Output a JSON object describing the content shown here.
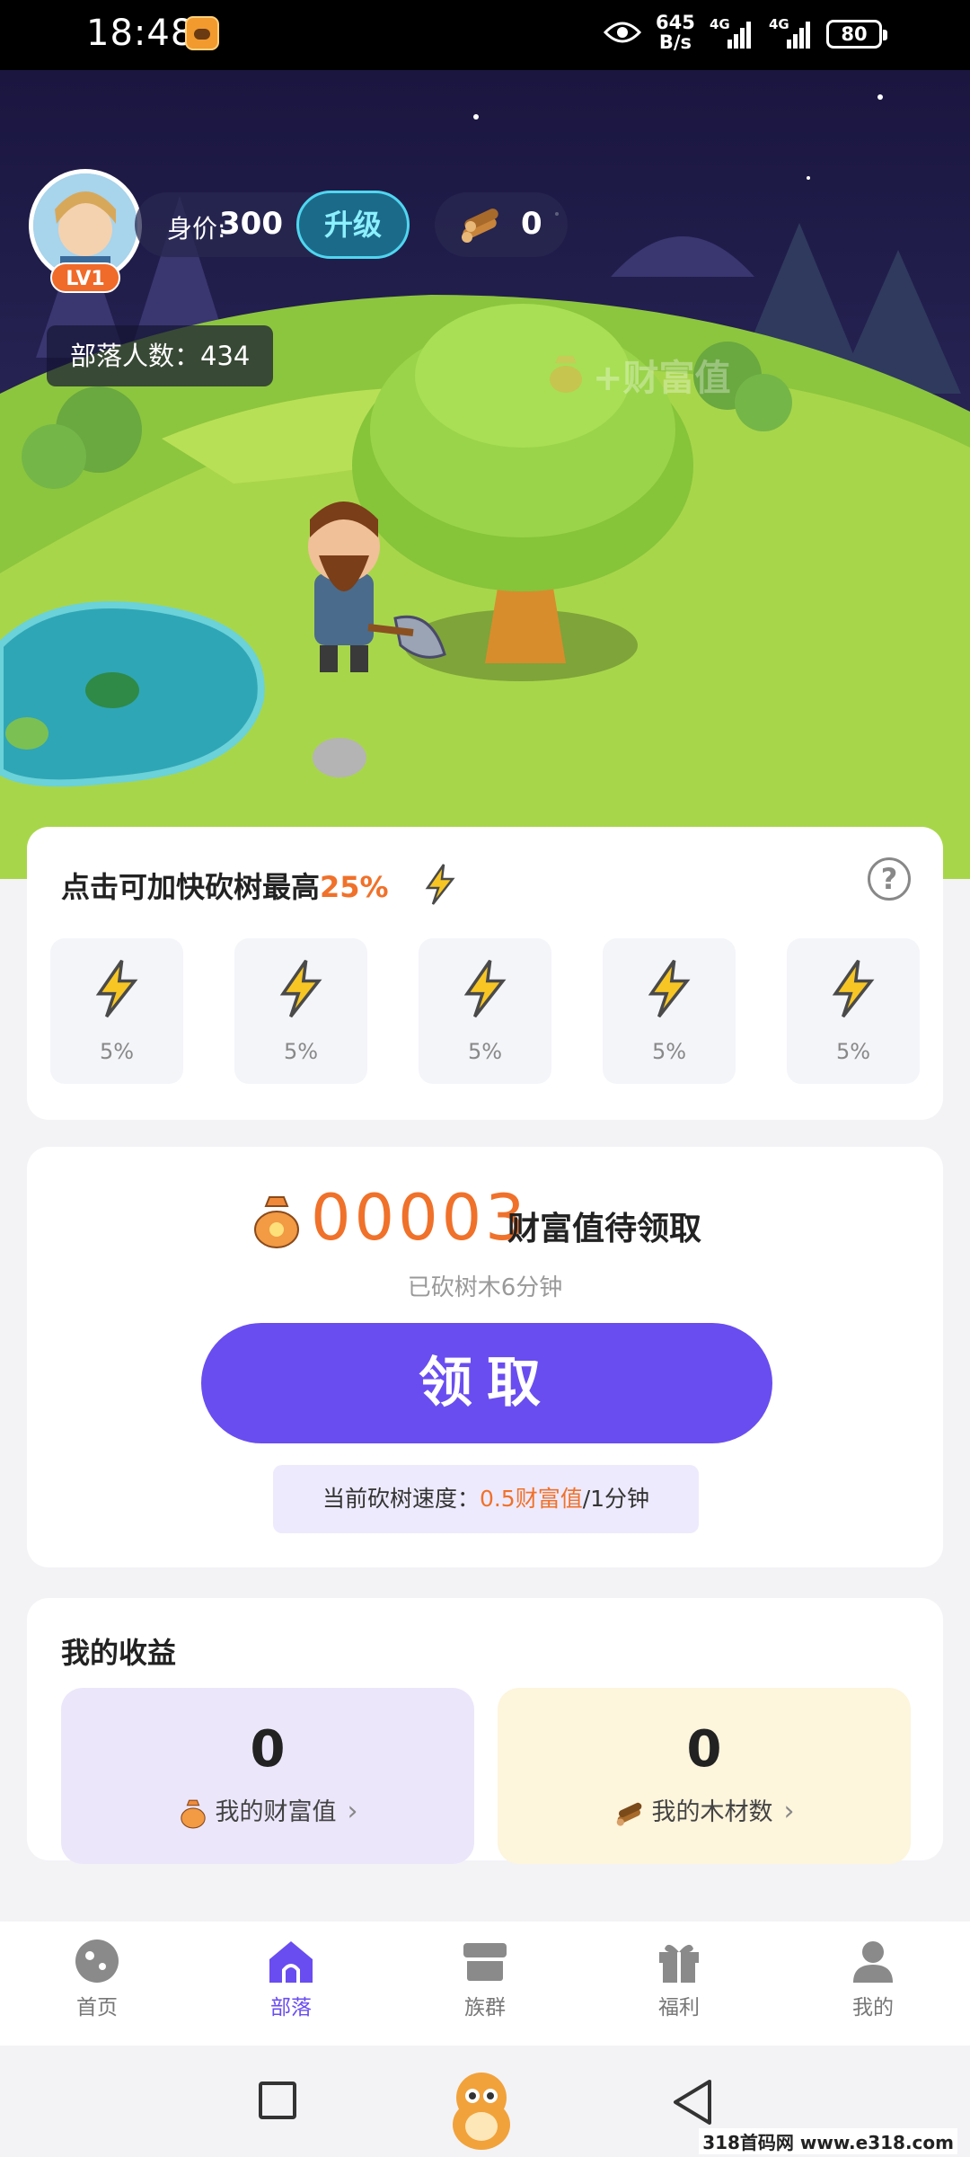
{
  "status_bar": {
    "time": "18:48",
    "net_speed_value": "645",
    "net_speed_unit": "B/s",
    "net1": "4G",
    "net2": "4G",
    "battery": "80"
  },
  "header": {
    "level": "LV1",
    "value_label": "身价:",
    "value_num": "300",
    "upgrade_label": "升级",
    "wood_count": "0",
    "tribe_count": "部落人数：434",
    "float_text": "+财富值"
  },
  "speed_card": {
    "title_prefix": "点击可加快砍树最高",
    "title_pct": "25%",
    "help_symbol": "?",
    "boosts": [
      {
        "label": "5%"
      },
      {
        "label": "5%"
      },
      {
        "label": "5%"
      },
      {
        "label": "5%"
      },
      {
        "label": "5%"
      }
    ]
  },
  "wealth_card": {
    "counter": "00003",
    "pending_label": "财富值待领取",
    "chop_time": "已砍树木6分钟",
    "claim_label": "领取",
    "rate_prefix": "当前砍树速度：",
    "rate_value": "0.5财富值",
    "rate_suffix": "/1分钟"
  },
  "earnings": {
    "title": "我的收益",
    "wealth_num": "0",
    "wealth_label": "我的财富值",
    "wood_num": "0",
    "wood_label": "我的木材数"
  },
  "bottom_nav": {
    "items": [
      {
        "label": "首页"
      },
      {
        "label": "部落"
      },
      {
        "label": "族群"
      },
      {
        "label": "福利"
      },
      {
        "label": "我的"
      }
    ]
  },
  "watermark": "318首码网 www.e318.com",
  "colors": {
    "accent": "#6a4df0",
    "orange": "#f0712a"
  }
}
